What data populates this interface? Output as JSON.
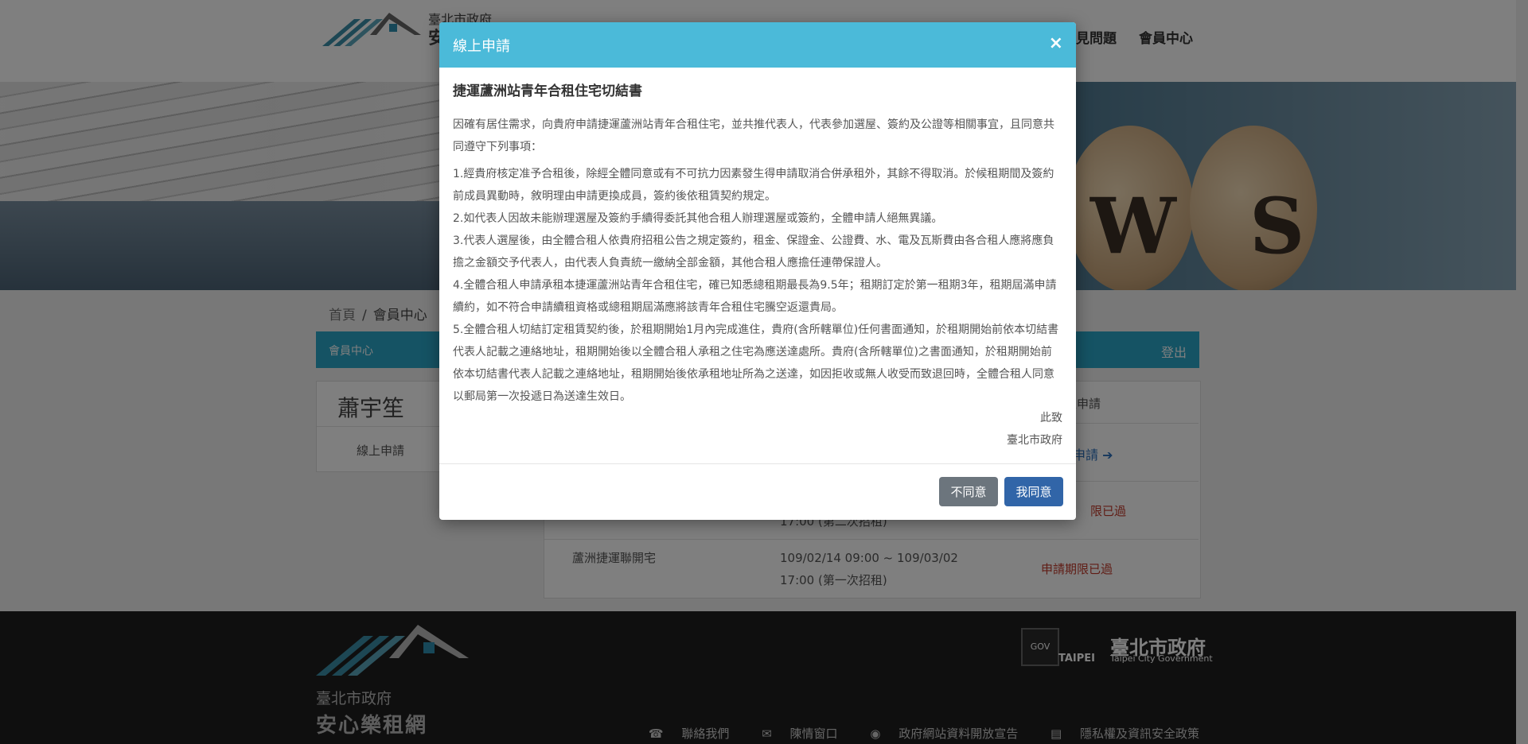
{
  "header": {
    "org_name": "臺北市政府",
    "site_name": "安",
    "nav_partial": "見問題",
    "nav_member": "會員中心"
  },
  "banner": {
    "letters": [
      "W",
      "S"
    ]
  },
  "breadcrumb": {
    "home": "首頁",
    "separator": "/",
    "current": "會員中心"
  },
  "member_bar": {
    "title": "會員中心",
    "logout": "登出"
  },
  "sidebar": {
    "user_name": "蕭宇笙",
    "menu_item": "線上申請"
  },
  "table": {
    "header_partial": "上申請",
    "row1_action": "申請",
    "row2_time_partial": "17:00 (第二次招租)",
    "row2_status": "限已過",
    "row3_name": "蘆洲捷運聯開宅",
    "row3_time_line1": "109/02/14 09:00 ~ 109/03/02",
    "row3_time_line2": "17:00 (第一次招租)",
    "row3_status": "申請期限已過"
  },
  "footer": {
    "org_name": "臺北市政府",
    "site_name": "安心樂租網",
    "gov_logo": "GOV",
    "taipei_mark": "TAIPEI",
    "taipei_name": "臺北市政府",
    "taipei_name_en": "Taipei City Government",
    "links": [
      "聯絡我們",
      "陳情窗口",
      "政府網站資料開放宣告",
      "隱私權及資訊安全政策"
    ]
  },
  "modal": {
    "title": "線上申請",
    "close": "×",
    "doc_title": "捷運蘆洲站青年合租住宅切結書",
    "intro": "因確有居住需求，向貴府申請捷運蘆洲站青年合租住宅，並共推代表人，代表參加選屋、簽約及公證等相關事宜，且同意共同遵守下列事項：",
    "items": [
      "1.經貴府核定准予合租後，除經全體同意或有不可抗力因素發生得申請取消合併承租外，其餘不得取消。於候租期間及簽約前成員異動時，敘明理由申請更換成員，簽約後依租賃契約規定。",
      "2.如代表人因故未能辦理選屋及簽約手續得委託其他合租人辦理選屋或簽約，全體申請人絕無異議。",
      "3.代表人選屋後，由全體合租人依貴府招租公告之規定簽約，租金、保證金、公證費、水、電及瓦斯費由各合租人應將應負擔之金額交予代表人，由代表人負責統一繳納全部金額，其他合租人應擔任連帶保證人。",
      "4.全體合租人申請承租本捷運蘆洲站青年合租住宅，確已知悉總租期最長為9.5年；租期訂定於第一租期3年，租期屆滿申請續約，如不符合申請續租資格或總租期屆滿應將該青年合租住宅騰空返還貴局。",
      "5.全體合租人切結訂定租賃契約後，於租期開始1月內完成進住，貴府(含所轄單位)任何書面通知，於租期開始前依本切結書代表人記載之連絡地址，租期開始後以全體合租人承租之住宅為應送達處所。貴府(含所轄單位)之書面通知，於租期開始前依本切結書代表人記載之連絡地址，租期開始後依承租地址所為之送達，如因拒收或無人收受而致退回時，全體合租人同意以郵局第一次投遞日為送達生效日。"
    ],
    "closing1": "此致",
    "closing2": "臺北市政府",
    "btn_disagree": "不同意",
    "btn_agree": "我同意"
  }
}
